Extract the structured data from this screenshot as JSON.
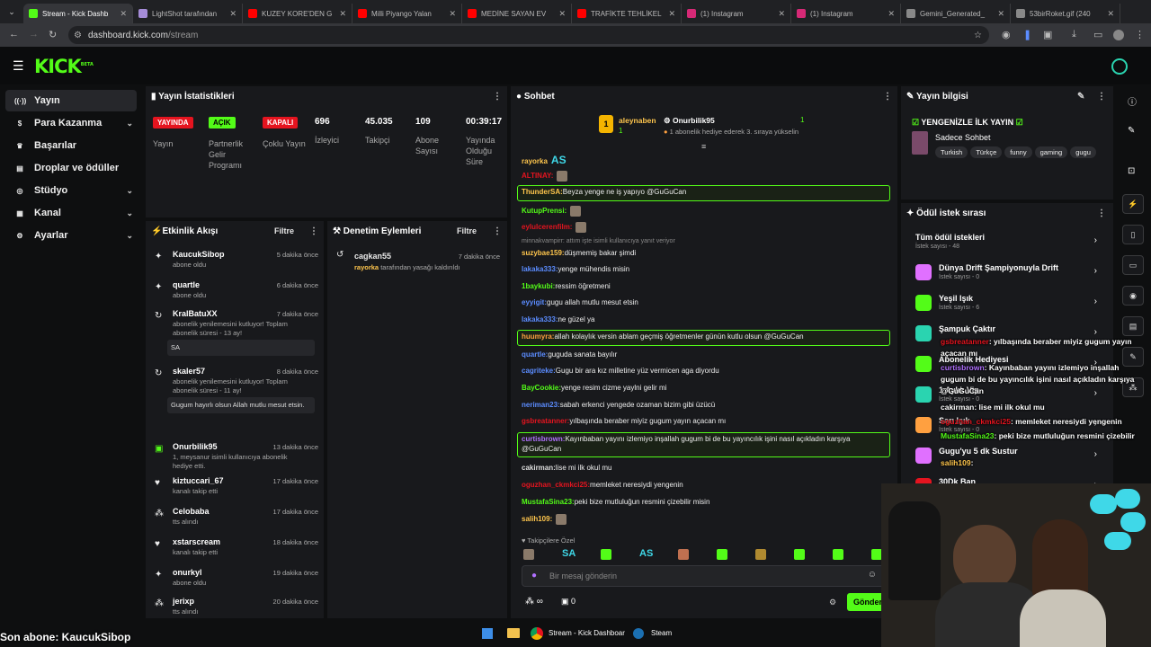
{
  "browser": {
    "tabs": [
      {
        "label": "Stream - Kick Dashb",
        "color": "#53fc18",
        "active": true
      },
      {
        "label": "LightShot tarafından",
        "color": "#a58cd8"
      },
      {
        "label": "KUZEY KORE'DEN G",
        "color": "#ff0000"
      },
      {
        "label": "Milli Piyango Yalan",
        "color": "#ff0000"
      },
      {
        "label": "MEDİNE SAYAN EV",
        "color": "#ff0000"
      },
      {
        "label": "TRAFİKTE TEHLİKEL",
        "color": "#ff0000"
      },
      {
        "label": "(1) Instagram",
        "color": "#d62976"
      },
      {
        "label": "(1) Instagram",
        "color": "#d62976"
      },
      {
        "label": "Gemini_Generated_",
        "color": "#888888"
      },
      {
        "label": "53birRoket.gif (240",
        "color": "#888888"
      }
    ],
    "url_host": "dashboard.kick.com",
    "url_path": "/stream"
  },
  "logo": "KICK",
  "logo_beta": "BETA",
  "sidebar": [
    {
      "icon": "broadcast-icon",
      "label": "Yayın",
      "active": true
    },
    {
      "icon": "dollar-icon",
      "label": "Para Kazanma",
      "chev": true
    },
    {
      "icon": "trophy-icon",
      "label": "Başarılar"
    },
    {
      "icon": "gift-icon",
      "label": "Droplar ve ödüller"
    },
    {
      "icon": "studio-icon",
      "label": "Stüdyo",
      "chev": true
    },
    {
      "icon": "channel-icon",
      "label": "Kanal",
      "chev": true
    },
    {
      "icon": "gear-icon",
      "label": "Ayarlar",
      "chev": true
    }
  ],
  "stats": {
    "title": "Yayın İstatistikleri",
    "items": [
      {
        "badge": "YAYINDA",
        "badge_color": "#e5141f",
        "label": "Yayın"
      },
      {
        "badge": "AÇIK",
        "badge_color": "#53fc18",
        "label": "Partnerlik Gelir Programı"
      },
      {
        "badge": "KAPALI",
        "badge_color": "#e5141f",
        "label": "Çoklu Yayın"
      },
      {
        "value": "696",
        "label": "İzleyici"
      },
      {
        "value": "45.035",
        "label": "Takipçi"
      },
      {
        "value": "109",
        "label": "Abone Sayısı"
      },
      {
        "value": "00:39:17",
        "label": "Yayında Olduğu Süre"
      }
    ]
  },
  "activity": {
    "title": "Etkinlik Akışı",
    "filter": "Filtre",
    "events": [
      {
        "icon": "star-icon",
        "name": "KaucukSibop",
        "time": "5 dakika önce",
        "sub": "abone oldu"
      },
      {
        "icon": "star-icon",
        "name": "quartle",
        "time": "6 dakika önce",
        "sub": "abone oldu"
      },
      {
        "icon": "refresh-icon",
        "name": "KralBatuXX",
        "time": "7 dakika önce",
        "sub": "abonelik yenilemesini kutluyor! Toplam abonelik süresi - 13 ay!",
        "msg": "SA"
      },
      {
        "icon": "refresh-icon",
        "name": "skaler57",
        "time": "8 dakika önce",
        "sub": "abonelik yenilemesini kutluyor! Toplam abonelik süresi - 11 ay!",
        "msg": "Gugum hayırlı olsun Allah mutlu mesut etsin."
      },
      {
        "icon": "gift-icon",
        "name": "Onurbilik95",
        "time": "13 dakika önce",
        "sub": "1, meysanur isimli kullanıcıya abonelik hediye etti."
      },
      {
        "icon": "heart-icon",
        "name": "kiztuccari_67",
        "time": "17 dakika önce",
        "sub": "kanalı takip etti"
      },
      {
        "icon": "drops-icon",
        "name": "Celobaba",
        "time": "17 dakika önce",
        "sub": "tts alındı"
      },
      {
        "icon": "heart-icon",
        "name": "xstarscream",
        "time": "18 dakika önce",
        "sub": "kanalı takip etti"
      },
      {
        "icon": "star-icon",
        "name": "onurkyl",
        "time": "19 dakika önce",
        "sub": "abone oldu"
      },
      {
        "icon": "drops-icon",
        "name": "jerixp",
        "time": "20 dakika önce",
        "sub": "tts alındı"
      }
    ]
  },
  "moderation": {
    "title": "Denetim Eylemleri",
    "filter": "Filtre",
    "events": [
      {
        "name": "cagkan55",
        "time": "7 dakika önce",
        "actor": "rayorka",
        "sub": "tarafından yasağı kaldırıldı"
      }
    ]
  },
  "chat": {
    "title": "Sohbet",
    "pinned_left": "aleynaben",
    "pinned_left_count": "1",
    "pinned_right": "Onurbilik95",
    "pinned_right_count": "1",
    "pinned_msg": "1 abonelik hediye ederek 3. sıraya yükselin",
    "lines": [
      {
        "user": "rayorka",
        "color": "#ffc64d",
        "text": "",
        "emote": "AS"
      },
      {
        "user": "ALTINAY:",
        "color": "#e5141f",
        "text": ""
      },
      {
        "user": "ThunderSA:",
        "color": "#ffc64d",
        "text": "Beyza yenge ne iş yapıyo @GuGuCan",
        "hl": true
      },
      {
        "user": "KutupPrensi:",
        "color": "#53fc18",
        "text": ""
      },
      {
        "user": "eylulcerenfilm:",
        "color": "#e5141f",
        "text": ""
      },
      {
        "reply": "minnakvampirr: attım işte isimli kullanıcıya yanıt veriyor"
      },
      {
        "user": "suzybae159:",
        "color": "#ffc64d",
        "text": "düşmemiş bakar şimdi"
      },
      {
        "user": "lakaka333:",
        "color": "#5b8cff",
        "text": "yenge mühendis misin"
      },
      {
        "user": "1baykubi:",
        "color": "#53fc18",
        "text": "ressim öğretmeni"
      },
      {
        "user": "eyyigit:",
        "color": "#5b8cff",
        "text": "gugu allah mutlu mesut etsin"
      },
      {
        "user": "lakaka333:",
        "color": "#5b8cff",
        "text": "ne güzel ya"
      },
      {
        "user": "huumyra:",
        "color": "#ffa040",
        "text": "allah kolaylık versin ablam geçmiş öğretmenler günün kutlu olsun @GuGuCan",
        "hl": true
      },
      {
        "user": "quartle:",
        "color": "#5b8cff",
        "text": "guguda sanata bayılır"
      },
      {
        "user": "cagriteke:",
        "color": "#5b8cff",
        "text": "Gugu bir ara kız milletine yüz vermicen aga diyordu"
      },
      {
        "user": "BayCookie:",
        "color": "#53fc18",
        "text": "yenge resim cizme yaylni gelir mi"
      },
      {
        "user": "neriman23:",
        "color": "#5b8cff",
        "text": "sabah erkenci yengede ozaman bizim gibi üzücü"
      },
      {
        "user": "gsbreatanner:",
        "color": "#e5141f",
        "text": "yılbaşında beraber miyiz gugum yayın açacan mı"
      },
      {
        "user": "curtisbrown:",
        "color": "#b070ff",
        "text": "Kayınbaban yayını izlemiyo inşallah gugum bi de bu yayıncılık işini nasıl açıkladın karşıya",
        "text2": "@GuGuCan",
        "hl": true
      },
      {
        "user": "cakirman:",
        "color": "#dddddd",
        "text": "lise mi ilk okul mu"
      },
      {
        "user": "oguzhan_ckmkci25:",
        "color": "#e5141f",
        "text": "memleket neresiydi yengenin"
      },
      {
        "user": "MustafaSina23:",
        "color": "#53fc18",
        "text": "peki bize mutluluğun resmini çizebilir misin"
      },
      {
        "user": "salih109:",
        "color": "#ffc64d",
        "text": ""
      }
    ],
    "followers_only": "Takipçilere Özel",
    "emotes": [
      "SA",
      "AS"
    ],
    "placeholder": "Bir mesaj gönderin",
    "infinity": "∞",
    "points": "0",
    "send": "Gönder"
  },
  "stream_info": {
    "title": "Yayın bilgisi",
    "stream_title": "YENGENİZLE İLK YAYIN",
    "category": "Sadece Sohbet",
    "tags": [
      "Turkish",
      "Türkçe",
      "funny",
      "gaming",
      "gugu"
    ]
  },
  "rewards": {
    "title": "Ödül istek sırası",
    "items": [
      {
        "title": "Tüm ödül istekleri",
        "sub": "İstek sayısı - 48",
        "color": ""
      },
      {
        "title": "Dünya Drift Şampiyonuyla Drift",
        "sub": "İstek sayısı - 0",
        "color": "#e070ff"
      },
      {
        "title": "Yeşil Işık",
        "sub": "İstek sayısı - 6",
        "color": "#53fc18"
      },
      {
        "title": "Şampuk Çaktır",
        "sub": "",
        "color": "#2ad4b0"
      },
      {
        "title": "Abonelik Hediyesi",
        "sub": "",
        "color": "#53fc18"
      },
      {
        "title": "1 Aylık Vip",
        "sub": "İstek sayısı - 0",
        "color": "#2ad4b0"
      },
      {
        "title": "Sarı Işık",
        "sub": "İstek sayısı - 0",
        "color": "#ffa040"
      },
      {
        "title": "Gugu'yu 5 dk Sustur",
        "sub": "",
        "color": "#e070ff"
      },
      {
        "title": "30Dk Ban",
        "sub": "",
        "color": "#e5141f"
      }
    ]
  },
  "overlay_chat": [
    {
      "user": "gsbreatanner",
      "text": ": yılbaşında beraber miyiz gugum yayın",
      "text2": "açacan mı",
      "ucolor": "#e5141f"
    },
    {
      "user": "curtisbrown",
      "text": ": Kayınbaban yayını izlemiyo inşallah",
      "text2": "gugum bi de bu yayıncılık işini nasıl açıkladın karşıya",
      "text3": "@GuGuCan",
      "ucolor": "#b070ff"
    },
    {
      "user": "cakirman",
      "text": ": lise mi ilk okul mu",
      "ucolor": "#ffffff"
    },
    {
      "user": "oguzhan_ckmkci25",
      "text": ": memleket neresiydi yengenin",
      "ucolor": "#e5141f"
    },
    {
      "user": "MustafaSina23",
      "text": ": peki bize mutluluğun resmini çizebilir",
      "ucolor": "#53fc18"
    },
    {
      "user": "salih109",
      "text": ":",
      "ucolor": "#ffc64d"
    }
  ],
  "last_sub": "Son abone: KaucukSibop",
  "taskbar": [
    {
      "icon": "chrome-icon",
      "label": "Stream - Kick Dashboar"
    },
    {
      "icon": "steam-icon",
      "label": "Steam"
    }
  ]
}
